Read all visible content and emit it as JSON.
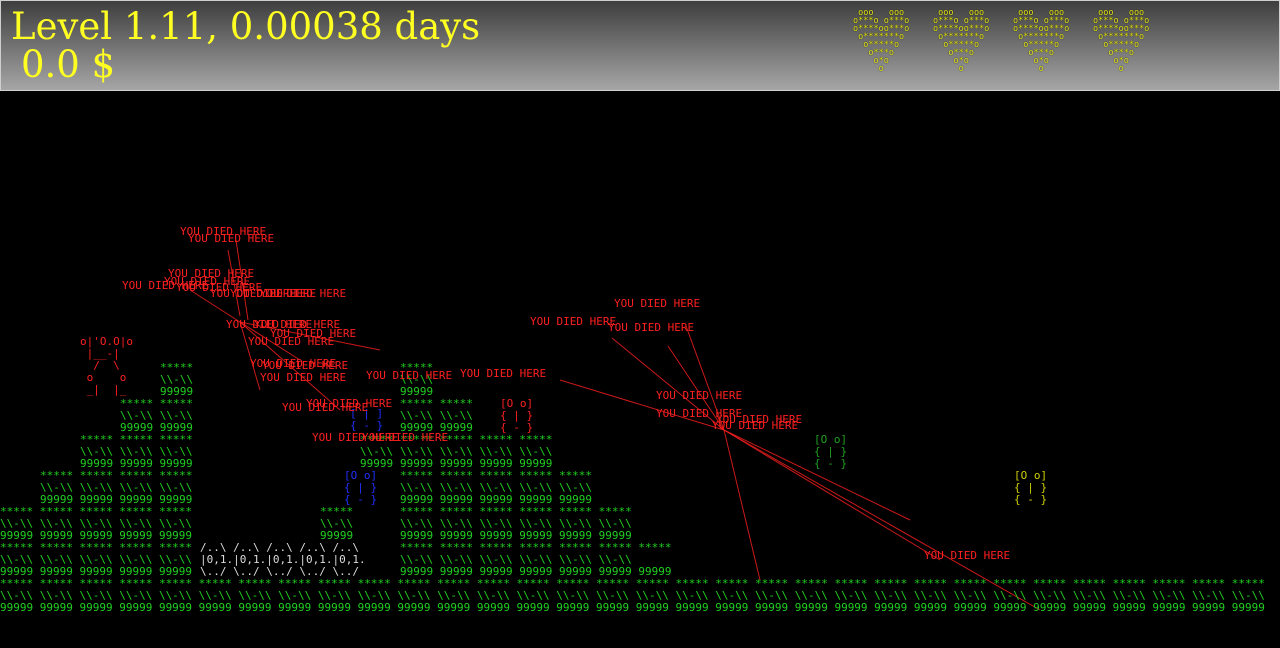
{
  "hud": {
    "level_text": "Level 1.11, 0.00038 days",
    "money_text": "0.0 $",
    "lives": 4,
    "heart_icon": "heart-icon",
    "color": "#ffff22"
  },
  "death_marker_text": "YOU DIED HERE",
  "colors": {
    "ground": "#20d020",
    "death": "#ff2020",
    "player": "#2030ff"
  }
}
